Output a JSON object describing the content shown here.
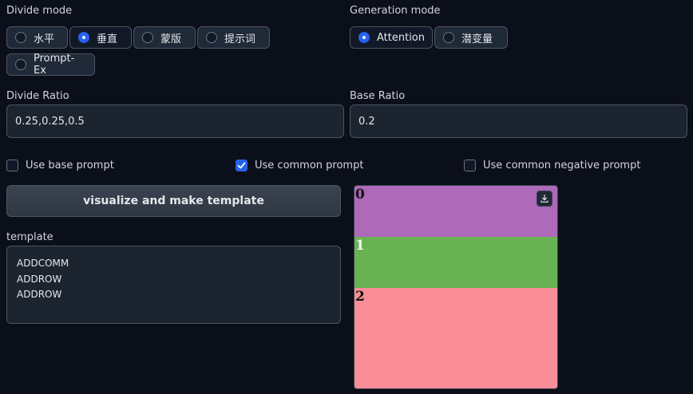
{
  "divide_mode": {
    "label": "Divide mode",
    "options": [
      "水平",
      "垂直",
      "蒙版",
      "提示词",
      "Prompt-Ex"
    ],
    "selected": "垂直"
  },
  "generation_mode": {
    "label": "Generation mode",
    "options": [
      "Attention",
      "潜变量"
    ],
    "selected": "Attention"
  },
  "divide_ratio": {
    "label": "Divide Ratio",
    "value": "0.25,0.25,0.5"
  },
  "base_ratio": {
    "label": "Base Ratio",
    "value": "0.2"
  },
  "checkboxes": [
    {
      "label": "Use base prompt",
      "checked": false
    },
    {
      "label": "Use common prompt",
      "checked": true
    },
    {
      "label": "Use common negative prompt",
      "checked": false
    }
  ],
  "visualize_button": "visualize and make template",
  "template": {
    "label": "template",
    "lines": [
      "ADDCOMM",
      "ADDROW",
      "ADDROW"
    ]
  },
  "preview": {
    "regions": [
      {
        "label": "0",
        "fraction": 0.25,
        "color": "#ae69b8"
      },
      {
        "label": "1",
        "fraction": 0.25,
        "color": "#69b254"
      },
      {
        "label": "2",
        "fraction": 0.5,
        "color": "#f98e98"
      }
    ],
    "download_icon": "download-icon"
  },
  "colors": {
    "accent": "#2563eb",
    "background": "#0b0f19"
  }
}
